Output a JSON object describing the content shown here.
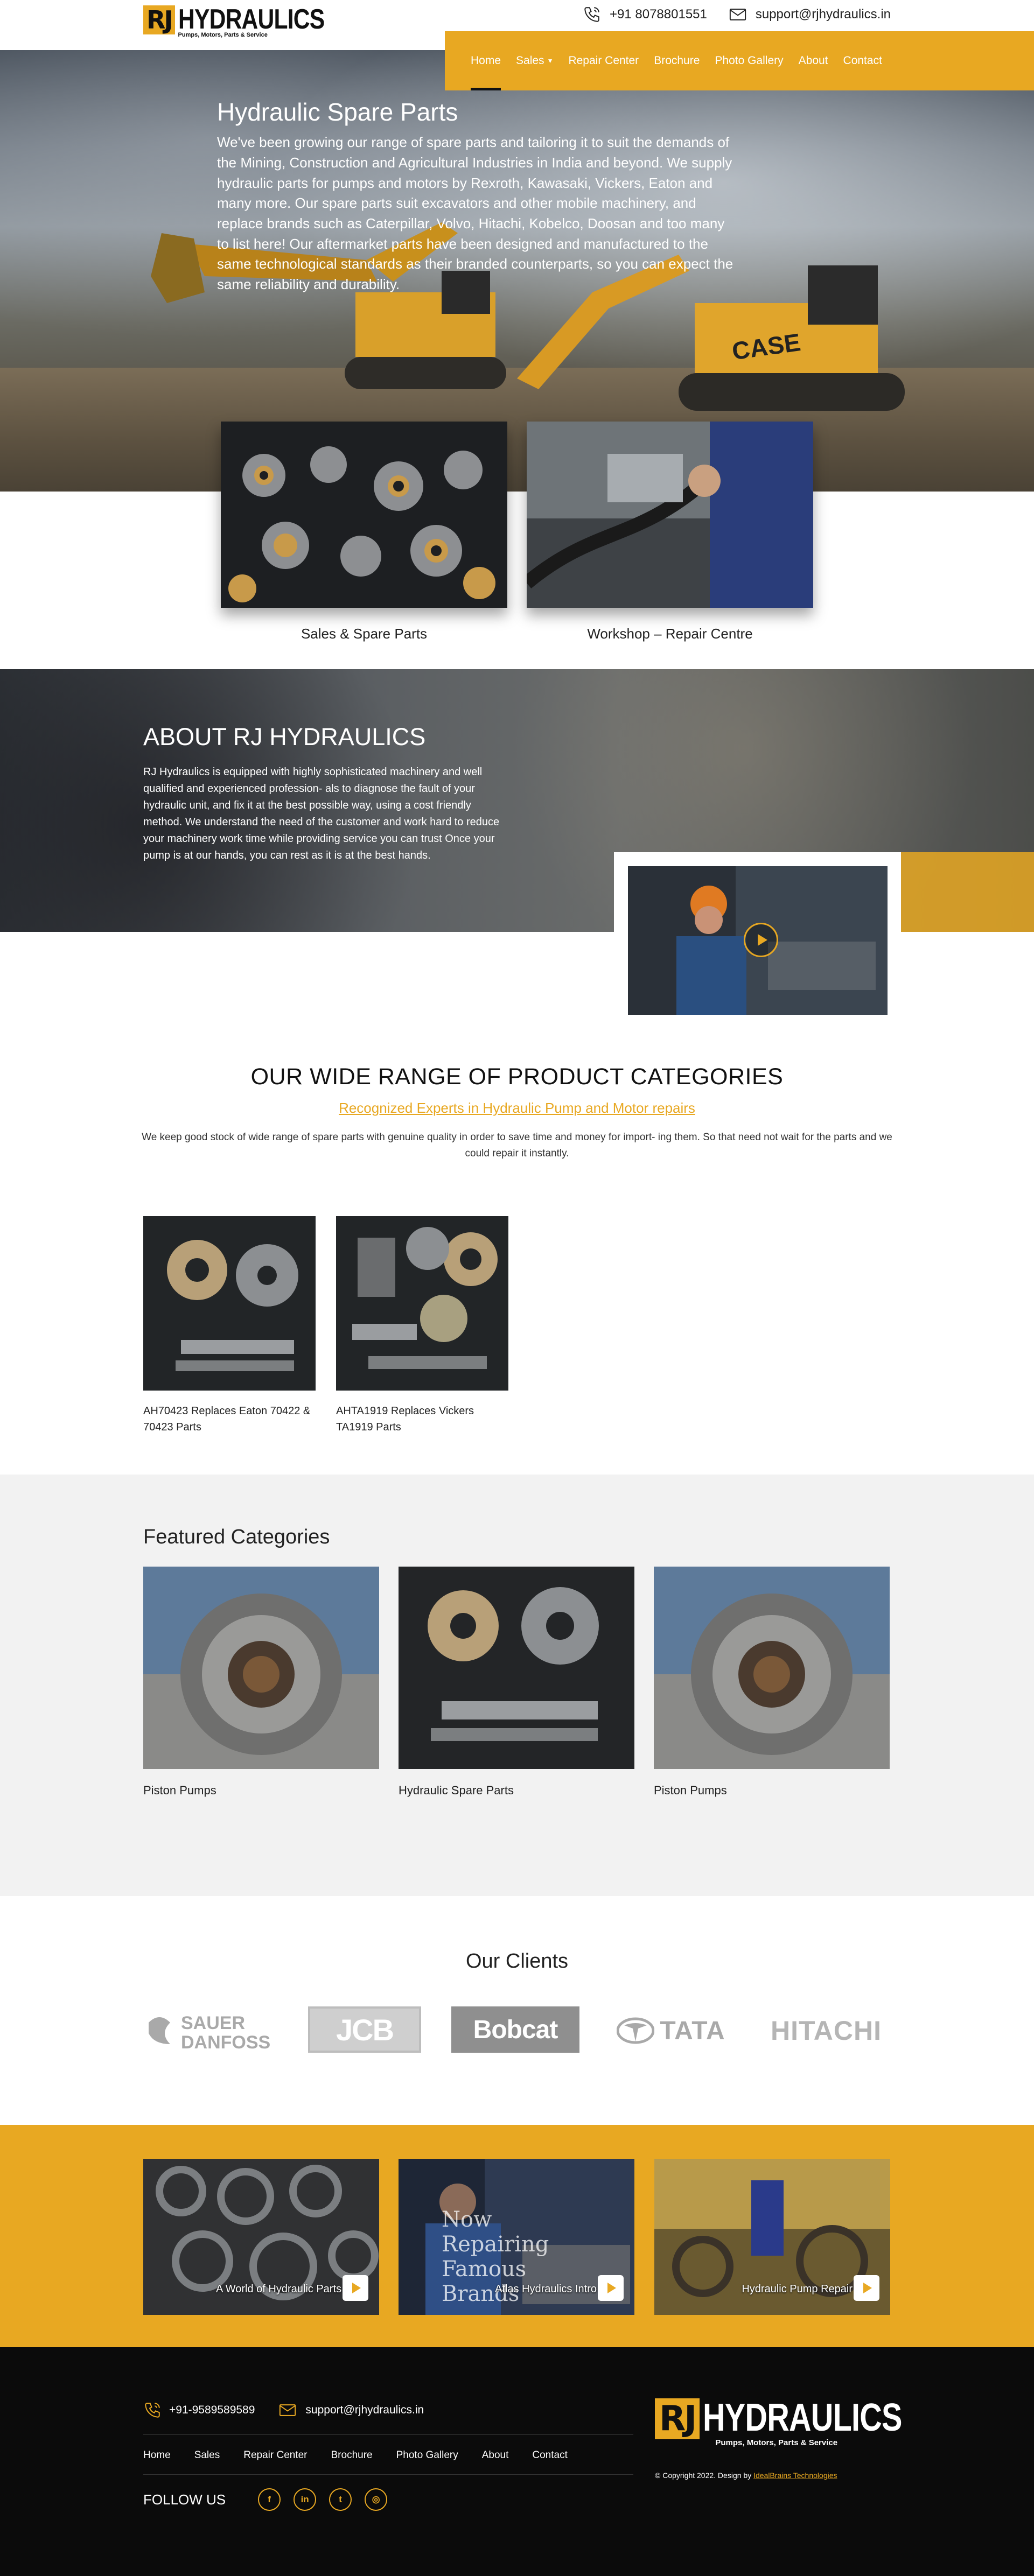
{
  "header": {
    "logo_mark": "RJ",
    "logo_name": "HYDRAULICS",
    "logo_tagline": "Pumps, Motors, Parts & Service",
    "phone": "+91 8078801551",
    "email": "support@rjhydraulics.in"
  },
  "nav": {
    "items": [
      {
        "label": "Home",
        "active": true
      },
      {
        "label": "Sales",
        "dropdown": true
      },
      {
        "label": "Repair Center"
      },
      {
        "label": "Brochure"
      },
      {
        "label": "Photo Gallery"
      },
      {
        "label": "About"
      },
      {
        "label": "Contact"
      }
    ]
  },
  "hero": {
    "title": "Hydraulic Spare Parts",
    "body": "We've been growing our range of spare parts and tailoring it to suit the demands of the Mining, Construction and Agricultural Industries in India and beyond. We supply hydraulic parts for pumps and motors by Rexroth, Kawasaki, Vickers, Eaton and many more. Our spare parts suit excavators and other mobile machinery, and replace brands such as Caterpillar, Volvo, Hitachi, Kobelco, Doosan and too many to list here! Our aftermarket parts have been designed and manufactured to the same technological standards as their branded counterparts, so you can expect the same reliability and durability."
  },
  "services": [
    {
      "caption": "Sales & Spare Parts"
    },
    {
      "caption": "Workshop – Repair Centre"
    }
  ],
  "about": {
    "title": "ABOUT RJ HYDRAULICS",
    "body": "RJ Hydraulics is equipped with highly sophisticated machinery and well qualified and experienced profession- als to diagnose the fault of your hydraulic unit, and fix it at the best possible way, using a cost friendly method. We understand the need of the customer and work hard to reduce your machinery work time while providing service you can trust Once your pump is at our hands, you can rest as it is at the best hands."
  },
  "products": {
    "title": "OUR WIDE RANGE OF PRODUCT CATEGORIES",
    "subtitle": "Recognized Experts in Hydraulic Pump and Motor repairs",
    "description": "We keep good stock of wide range of spare parts with genuine quality in order to save time and money for import- ing them. So that need not wait for the parts and we could repair it instantly.",
    "items": [
      {
        "caption": "AH70423 Replaces Eaton 70422 & 70423 Parts"
      },
      {
        "caption": "AHTA1919 Replaces Vickers TA1919 Parts"
      }
    ]
  },
  "featured": {
    "title": "Featured Categories",
    "items": [
      {
        "caption": "Piston Pumps"
      },
      {
        "caption": "Hydraulic Spare Parts"
      },
      {
        "caption": "Piston Pumps"
      }
    ]
  },
  "clients": {
    "title": "Our Clients",
    "logos": [
      {
        "line1": "SAUER",
        "line2": "DANFOSS"
      },
      {
        "name": "JCB"
      },
      {
        "name": "Bobcat"
      },
      {
        "name": "TATA"
      },
      {
        "name": "HITACHI"
      }
    ]
  },
  "videos": [
    {
      "label": "A World of Hydraulic Parts"
    },
    {
      "label": "Atlas Hydraulics Intro",
      "overlay": "Now Repairing Famous Brands"
    },
    {
      "label": "Hydraulic Pump Repair"
    }
  ],
  "footer": {
    "phone": "+91-9589589589",
    "email": "support@rjhydraulics.in",
    "nav": [
      "Home",
      "Sales",
      "Repair Center",
      "Brochure",
      "Photo Gallery",
      "About",
      "Contact"
    ],
    "follow_label": "FOLLOW US",
    "social": [
      {
        "icon": "facebook-icon",
        "glyph": "f"
      },
      {
        "icon": "linkedin-icon",
        "glyph": "in"
      },
      {
        "icon": "twitter-icon",
        "glyph": "t"
      },
      {
        "icon": "instagram-icon",
        "glyph": "◎"
      }
    ],
    "logo_mark": "RJ",
    "logo_name": "HYDRAULICS",
    "logo_tagline": "Pumps, Motors, Parts & Service",
    "copyright": "© Copyright 2022. Design by",
    "designer": "IdealBrains Technologies"
  },
  "colors": {
    "accent": "#e8a822",
    "dark": "#0b0b0b",
    "light_bg": "#f2f2f2"
  }
}
